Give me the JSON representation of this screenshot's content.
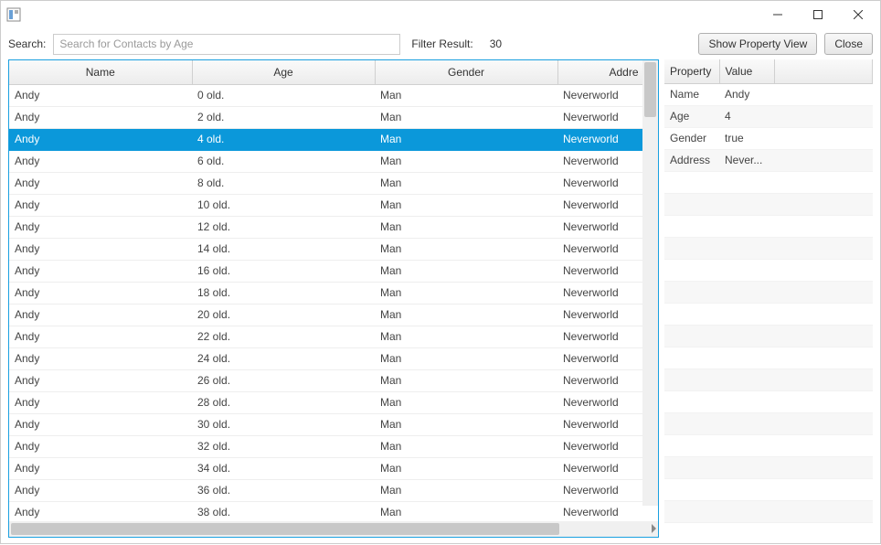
{
  "toolbar": {
    "search_label": "Search:",
    "search_placeholder": "Search for Contacts by Age",
    "search_value": "",
    "filter_label": "Filter Result:",
    "filter_value": "30",
    "show_property_label": "Show Property View",
    "close_label": "Close"
  },
  "main_table": {
    "columns": [
      "Name",
      "Age",
      "Gender",
      "Addre"
    ],
    "rows": [
      {
        "name": "Andy",
        "age": "0 old.",
        "gender": "Man",
        "address": "Neverworld",
        "selected": false
      },
      {
        "name": "Andy",
        "age": "2 old.",
        "gender": "Man",
        "address": "Neverworld",
        "selected": false
      },
      {
        "name": "Andy",
        "age": "4 old.",
        "gender": "Man",
        "address": "Neverworld",
        "selected": true
      },
      {
        "name": "Andy",
        "age": "6 old.",
        "gender": "Man",
        "address": "Neverworld",
        "selected": false
      },
      {
        "name": "Andy",
        "age": "8 old.",
        "gender": "Man",
        "address": "Neverworld",
        "selected": false
      },
      {
        "name": "Andy",
        "age": "10 old.",
        "gender": "Man",
        "address": "Neverworld",
        "selected": false
      },
      {
        "name": "Andy",
        "age": "12 old.",
        "gender": "Man",
        "address": "Neverworld",
        "selected": false
      },
      {
        "name": "Andy",
        "age": "14 old.",
        "gender": "Man",
        "address": "Neverworld",
        "selected": false
      },
      {
        "name": "Andy",
        "age": "16 old.",
        "gender": "Man",
        "address": "Neverworld",
        "selected": false
      },
      {
        "name": "Andy",
        "age": "18 old.",
        "gender": "Man",
        "address": "Neverworld",
        "selected": false
      },
      {
        "name": "Andy",
        "age": "20 old.",
        "gender": "Man",
        "address": "Neverworld",
        "selected": false
      },
      {
        "name": "Andy",
        "age": "22 old.",
        "gender": "Man",
        "address": "Neverworld",
        "selected": false
      },
      {
        "name": "Andy",
        "age": "24 old.",
        "gender": "Man",
        "address": "Neverworld",
        "selected": false
      },
      {
        "name": "Andy",
        "age": "26 old.",
        "gender": "Man",
        "address": "Neverworld",
        "selected": false
      },
      {
        "name": "Andy",
        "age": "28 old.",
        "gender": "Man",
        "address": "Neverworld",
        "selected": false
      },
      {
        "name": "Andy",
        "age": "30 old.",
        "gender": "Man",
        "address": "Neverworld",
        "selected": false
      },
      {
        "name": "Andy",
        "age": "32 old.",
        "gender": "Man",
        "address": "Neverworld",
        "selected": false
      },
      {
        "name": "Andy",
        "age": "34 old.",
        "gender": "Man",
        "address": "Neverworld",
        "selected": false
      },
      {
        "name": "Andy",
        "age": "36 old.",
        "gender": "Man",
        "address": "Neverworld",
        "selected": false
      },
      {
        "name": "Andy",
        "age": "38 old.",
        "gender": "Man",
        "address": "Neverworld",
        "selected": false
      }
    ]
  },
  "property_table": {
    "columns": [
      "Property",
      "Value"
    ],
    "rows": [
      {
        "property": "Name",
        "value": "Andy"
      },
      {
        "property": "Age",
        "value": "4"
      },
      {
        "property": "Gender",
        "value": "true"
      },
      {
        "property": "Address",
        "value": "Never..."
      }
    ],
    "empty_rows": 16
  },
  "colors": {
    "selection": "#0b98da",
    "focus_border": "#1aa0e0"
  }
}
